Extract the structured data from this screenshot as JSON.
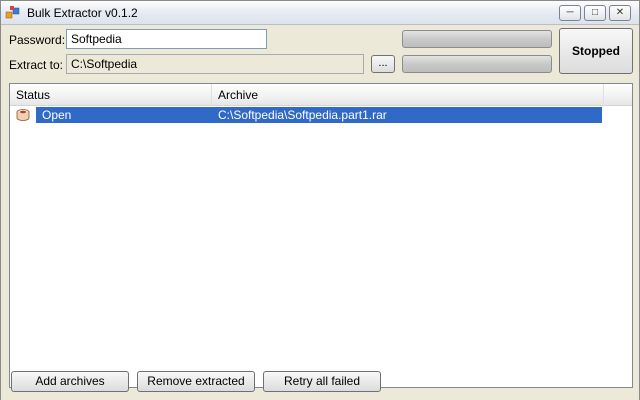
{
  "window": {
    "title": "Bulk Extractor v0.1.2",
    "controls": {
      "minimize": "─",
      "maximize": "□",
      "close": "✕"
    }
  },
  "form": {
    "password_label": "Password:",
    "password_value": "Softpedia",
    "extract_label": "Extract to:",
    "extract_value": "C:\\Softpedia",
    "browse_label": "...",
    "status_button": "Stopped"
  },
  "progress": {
    "bar1_fraction": 0,
    "bar2_fraction": 0
  },
  "list": {
    "columns": [
      "Status",
      "Archive"
    ],
    "rows": [
      {
        "status": "Open",
        "archive": "C:\\Softpedia\\Softpedia.part1.rar",
        "icon": "archive-icon"
      }
    ]
  },
  "footer": {
    "add_archives": "Add archives",
    "remove_extracted": "Remove extracted",
    "retry_all_failed": "Retry all failed"
  },
  "colors": {
    "selection": "#3169c6",
    "window_bg": "#ece9d8"
  }
}
